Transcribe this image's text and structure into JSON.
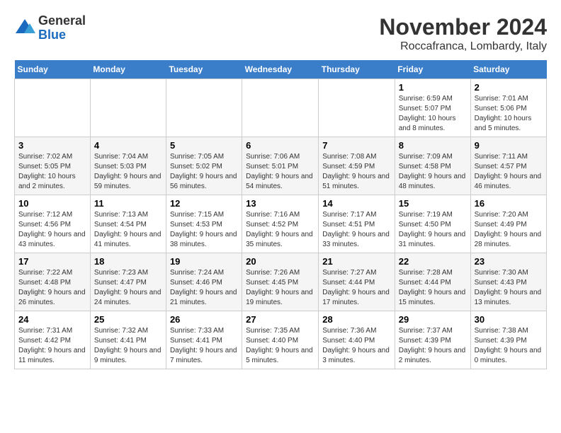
{
  "logo": {
    "general": "General",
    "blue": "Blue"
  },
  "title": "November 2024",
  "location": "Roccafranca, Lombardy, Italy",
  "headers": [
    "Sunday",
    "Monday",
    "Tuesday",
    "Wednesday",
    "Thursday",
    "Friday",
    "Saturday"
  ],
  "rows": [
    [
      {
        "day": "",
        "info": ""
      },
      {
        "day": "",
        "info": ""
      },
      {
        "day": "",
        "info": ""
      },
      {
        "day": "",
        "info": ""
      },
      {
        "day": "",
        "info": ""
      },
      {
        "day": "1",
        "info": "Sunrise: 6:59 AM\nSunset: 5:07 PM\nDaylight: 10 hours and 8 minutes."
      },
      {
        "day": "2",
        "info": "Sunrise: 7:01 AM\nSunset: 5:06 PM\nDaylight: 10 hours and 5 minutes."
      }
    ],
    [
      {
        "day": "3",
        "info": "Sunrise: 7:02 AM\nSunset: 5:05 PM\nDaylight: 10 hours and 2 minutes."
      },
      {
        "day": "4",
        "info": "Sunrise: 7:04 AM\nSunset: 5:03 PM\nDaylight: 9 hours and 59 minutes."
      },
      {
        "day": "5",
        "info": "Sunrise: 7:05 AM\nSunset: 5:02 PM\nDaylight: 9 hours and 56 minutes."
      },
      {
        "day": "6",
        "info": "Sunrise: 7:06 AM\nSunset: 5:01 PM\nDaylight: 9 hours and 54 minutes."
      },
      {
        "day": "7",
        "info": "Sunrise: 7:08 AM\nSunset: 4:59 PM\nDaylight: 9 hours and 51 minutes."
      },
      {
        "day": "8",
        "info": "Sunrise: 7:09 AM\nSunset: 4:58 PM\nDaylight: 9 hours and 48 minutes."
      },
      {
        "day": "9",
        "info": "Sunrise: 7:11 AM\nSunset: 4:57 PM\nDaylight: 9 hours and 46 minutes."
      }
    ],
    [
      {
        "day": "10",
        "info": "Sunrise: 7:12 AM\nSunset: 4:56 PM\nDaylight: 9 hours and 43 minutes."
      },
      {
        "day": "11",
        "info": "Sunrise: 7:13 AM\nSunset: 4:54 PM\nDaylight: 9 hours and 41 minutes."
      },
      {
        "day": "12",
        "info": "Sunrise: 7:15 AM\nSunset: 4:53 PM\nDaylight: 9 hours and 38 minutes."
      },
      {
        "day": "13",
        "info": "Sunrise: 7:16 AM\nSunset: 4:52 PM\nDaylight: 9 hours and 35 minutes."
      },
      {
        "day": "14",
        "info": "Sunrise: 7:17 AM\nSunset: 4:51 PM\nDaylight: 9 hours and 33 minutes."
      },
      {
        "day": "15",
        "info": "Sunrise: 7:19 AM\nSunset: 4:50 PM\nDaylight: 9 hours and 31 minutes."
      },
      {
        "day": "16",
        "info": "Sunrise: 7:20 AM\nSunset: 4:49 PM\nDaylight: 9 hours and 28 minutes."
      }
    ],
    [
      {
        "day": "17",
        "info": "Sunrise: 7:22 AM\nSunset: 4:48 PM\nDaylight: 9 hours and 26 minutes."
      },
      {
        "day": "18",
        "info": "Sunrise: 7:23 AM\nSunset: 4:47 PM\nDaylight: 9 hours and 24 minutes."
      },
      {
        "day": "19",
        "info": "Sunrise: 7:24 AM\nSunset: 4:46 PM\nDaylight: 9 hours and 21 minutes."
      },
      {
        "day": "20",
        "info": "Sunrise: 7:26 AM\nSunset: 4:45 PM\nDaylight: 9 hours and 19 minutes."
      },
      {
        "day": "21",
        "info": "Sunrise: 7:27 AM\nSunset: 4:44 PM\nDaylight: 9 hours and 17 minutes."
      },
      {
        "day": "22",
        "info": "Sunrise: 7:28 AM\nSunset: 4:44 PM\nDaylight: 9 hours and 15 minutes."
      },
      {
        "day": "23",
        "info": "Sunrise: 7:30 AM\nSunset: 4:43 PM\nDaylight: 9 hours and 13 minutes."
      }
    ],
    [
      {
        "day": "24",
        "info": "Sunrise: 7:31 AM\nSunset: 4:42 PM\nDaylight: 9 hours and 11 minutes."
      },
      {
        "day": "25",
        "info": "Sunrise: 7:32 AM\nSunset: 4:41 PM\nDaylight: 9 hours and 9 minutes."
      },
      {
        "day": "26",
        "info": "Sunrise: 7:33 AM\nSunset: 4:41 PM\nDaylight: 9 hours and 7 minutes."
      },
      {
        "day": "27",
        "info": "Sunrise: 7:35 AM\nSunset: 4:40 PM\nDaylight: 9 hours and 5 minutes."
      },
      {
        "day": "28",
        "info": "Sunrise: 7:36 AM\nSunset: 4:40 PM\nDaylight: 9 hours and 3 minutes."
      },
      {
        "day": "29",
        "info": "Sunrise: 7:37 AM\nSunset: 4:39 PM\nDaylight: 9 hours and 2 minutes."
      },
      {
        "day": "30",
        "info": "Sunrise: 7:38 AM\nSunset: 4:39 PM\nDaylight: 9 hours and 0 minutes."
      }
    ]
  ]
}
